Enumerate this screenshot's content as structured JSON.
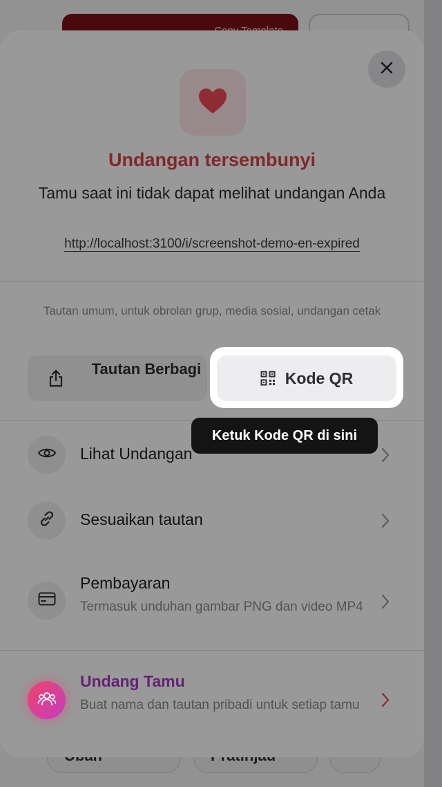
{
  "background": {
    "banner_text": "Copy Template",
    "bottom_buttons": [
      "Ubah",
      "Pratinjau"
    ]
  },
  "sheet": {
    "title": "Undangan tersembunyi",
    "subtitle": "Tamu saat ini tidak dapat melihat undangan Anda",
    "url": "http://localhost:3100/i/screenshot-demo-en-expired",
    "share_note": "Tautan umum, untuk obrolan grup, media sosial, undangan cetak",
    "share_button": "Tautan Berbagi",
    "qr_button": "Kode QR",
    "tooltip": "Ketuk Kode QR di sini",
    "menu": [
      {
        "label": "Lihat Undangan"
      },
      {
        "label": "Sesuaikan tautan"
      },
      {
        "label": "Pembayaran",
        "sub": "Termasuk unduhan gambar PNG dan video MP4"
      }
    ],
    "invite": {
      "label": "Undang Tamu",
      "sub": "Buat nama dan tautan pribadi untuk setiap tamu"
    }
  },
  "colors": {
    "accent_red": "#d6434c",
    "invite_purple": "#a63ac2"
  }
}
